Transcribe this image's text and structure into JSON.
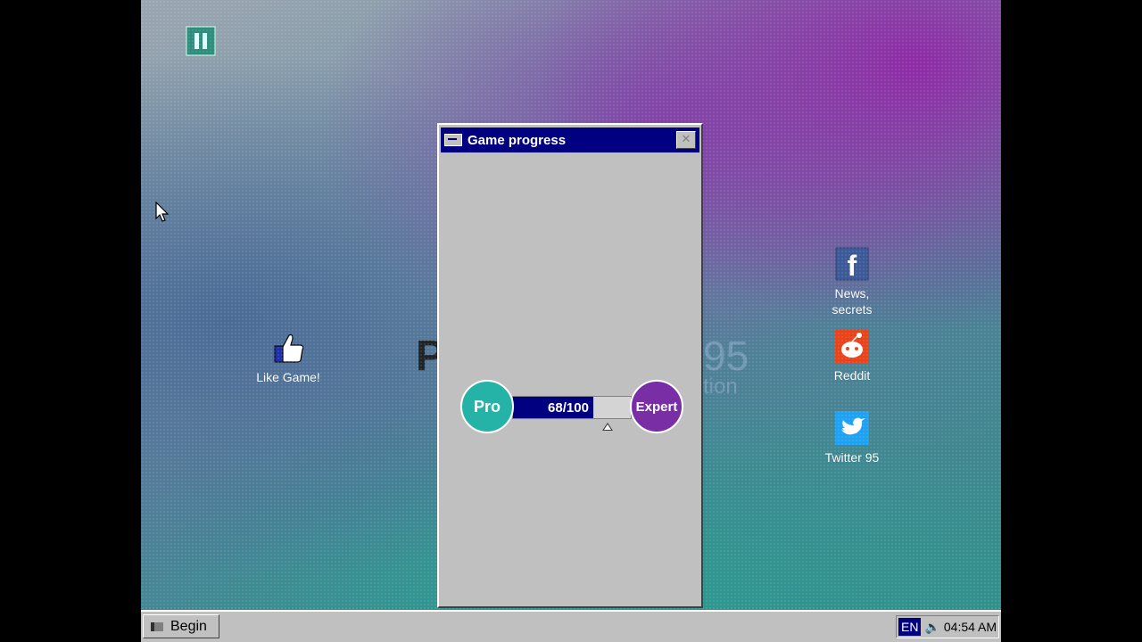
{
  "desktop": {
    "icons": [
      {
        "label": "",
        "icon": "pause-icon"
      },
      {
        "label": "Like Game!",
        "icon": "thumbs-up-icon"
      },
      {
        "label": "News, secrets",
        "icon": "facebook-icon"
      },
      {
        "label": "Reddit",
        "icon": "reddit-icon"
      },
      {
        "label": "Twitter 95",
        "icon": "twitter-icon"
      }
    ],
    "bg_logo_left": "P",
    "bg_logo_right": "95",
    "bg_logo_right_sub": "tion"
  },
  "window": {
    "title": "Game progress",
    "close_label": "✕",
    "progress": {
      "left_badge": "Pro",
      "right_badge": "Expert",
      "current": 68,
      "max": 100,
      "text": "68/100",
      "fraction": 0.68,
      "colors": {
        "left": "#25b3a7",
        "right": "#7a2ea6",
        "fill": "#000080"
      }
    }
  },
  "taskbar": {
    "start_label": "Begin",
    "language": "EN",
    "clock": "04:54 AM"
  }
}
